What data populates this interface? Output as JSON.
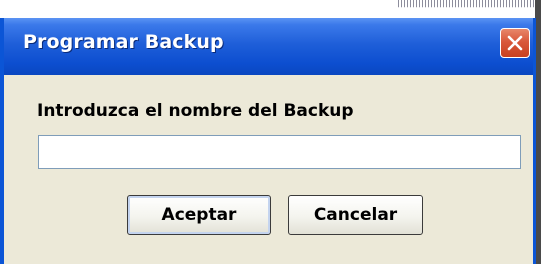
{
  "dialog": {
    "title": "Programar Backup",
    "close_icon": "close-icon",
    "prompt": "Introduzca el nombre del Backup",
    "input_value": "",
    "buttons": {
      "accept": "Aceptar",
      "cancel": "Cancelar"
    }
  },
  "colors": {
    "titlebar": "#0c4ed0",
    "window_bg": "#ece9d8",
    "close_button": "#d9583a"
  }
}
